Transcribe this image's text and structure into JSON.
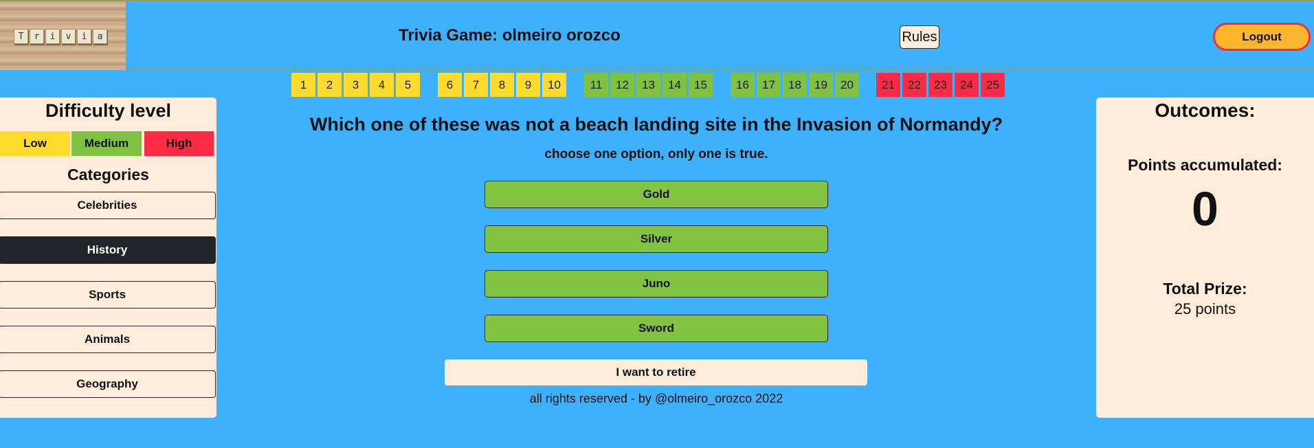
{
  "header": {
    "logo_letters": [
      "T",
      "r",
      "i",
      "v",
      "i",
      "a"
    ],
    "title": "Trivia Game: olmeiro orozco",
    "rules_label": "Rules",
    "logout_label": "Logout"
  },
  "levels": [
    {
      "n": "1",
      "tier": "low"
    },
    {
      "n": "2",
      "tier": "low"
    },
    {
      "n": "3",
      "tier": "low"
    },
    {
      "n": "4",
      "tier": "low"
    },
    {
      "n": "5",
      "tier": "low"
    },
    {
      "n": "6",
      "tier": "low"
    },
    {
      "n": "7",
      "tier": "low"
    },
    {
      "n": "8",
      "tier": "low"
    },
    {
      "n": "9",
      "tier": "low"
    },
    {
      "n": "10",
      "tier": "low"
    },
    {
      "n": "11",
      "tier": "medium"
    },
    {
      "n": "12",
      "tier": "medium"
    },
    {
      "n": "13",
      "tier": "medium"
    },
    {
      "n": "14",
      "tier": "medium"
    },
    {
      "n": "15",
      "tier": "medium"
    },
    {
      "n": "16",
      "tier": "medium"
    },
    {
      "n": "17",
      "tier": "medium"
    },
    {
      "n": "18",
      "tier": "medium"
    },
    {
      "n": "19",
      "tier": "medium"
    },
    {
      "n": "20",
      "tier": "medium"
    },
    {
      "n": "21",
      "tier": "high"
    },
    {
      "n": "22",
      "tier": "high"
    },
    {
      "n": "23",
      "tier": "high"
    },
    {
      "n": "24",
      "tier": "high"
    },
    {
      "n": "25",
      "tier": "high"
    }
  ],
  "colors": {
    "low": "#fedb2c",
    "medium": "#7fc141",
    "high": "#fc2a44",
    "background": "#3eb1fd",
    "panel": "#ffecdb"
  },
  "sidebar": {
    "difficulty_title": "Difficulty level",
    "difficulty": {
      "low": "Low",
      "medium": "Medium",
      "high": "High"
    },
    "categories_title": "Categories",
    "categories": [
      {
        "label": "Celebrities",
        "active": false
      },
      {
        "label": "History",
        "active": true
      },
      {
        "label": "Sports",
        "active": false
      },
      {
        "label": "Animals",
        "active": false
      },
      {
        "label": "Geography",
        "active": false
      }
    ]
  },
  "main": {
    "question": "Which one of these was not a beach landing site in the Invasion of Normandy?",
    "instruction": "choose one option, only one is true.",
    "answers": [
      "Gold",
      "Silver",
      "Juno",
      "Sword"
    ],
    "retire_label": "I want to retire",
    "footer": "all rights reserved - by @olmeiro_orozco 2022"
  },
  "outcomes": {
    "title": "Outcomes:",
    "points_label": "Points accumulated:",
    "points_value": "0",
    "prize_label": "Total Prize:",
    "prize_value": "25 points"
  }
}
